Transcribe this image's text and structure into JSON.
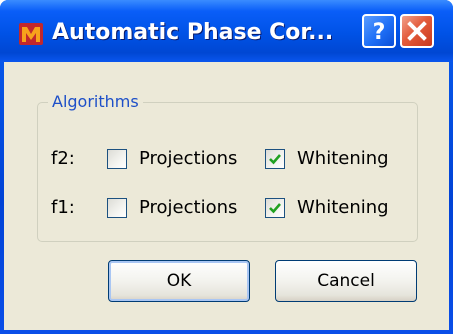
{
  "window": {
    "title": "Automatic Phase Cor...",
    "icon": "matlab-app-icon",
    "help_glyph": "?",
    "colors": {
      "titlebar": "#0052e6",
      "client": "#ece9d8",
      "group_label": "#1d4fc8",
      "close": "#e35c3c",
      "checkbox_border": "#1c5180",
      "checkmark": "#21a121"
    }
  },
  "group": {
    "label": "Algorithms",
    "rows": [
      {
        "label": "f2:",
        "options": [
          {
            "label": "Projections",
            "checked": false
          },
          {
            "label": "Whitening",
            "checked": true
          }
        ]
      },
      {
        "label": "f1:",
        "options": [
          {
            "label": "Projections",
            "checked": false
          },
          {
            "label": "Whitening",
            "checked": true
          }
        ]
      }
    ]
  },
  "buttons": {
    "ok_label": "OK",
    "cancel_label": "Cancel"
  }
}
